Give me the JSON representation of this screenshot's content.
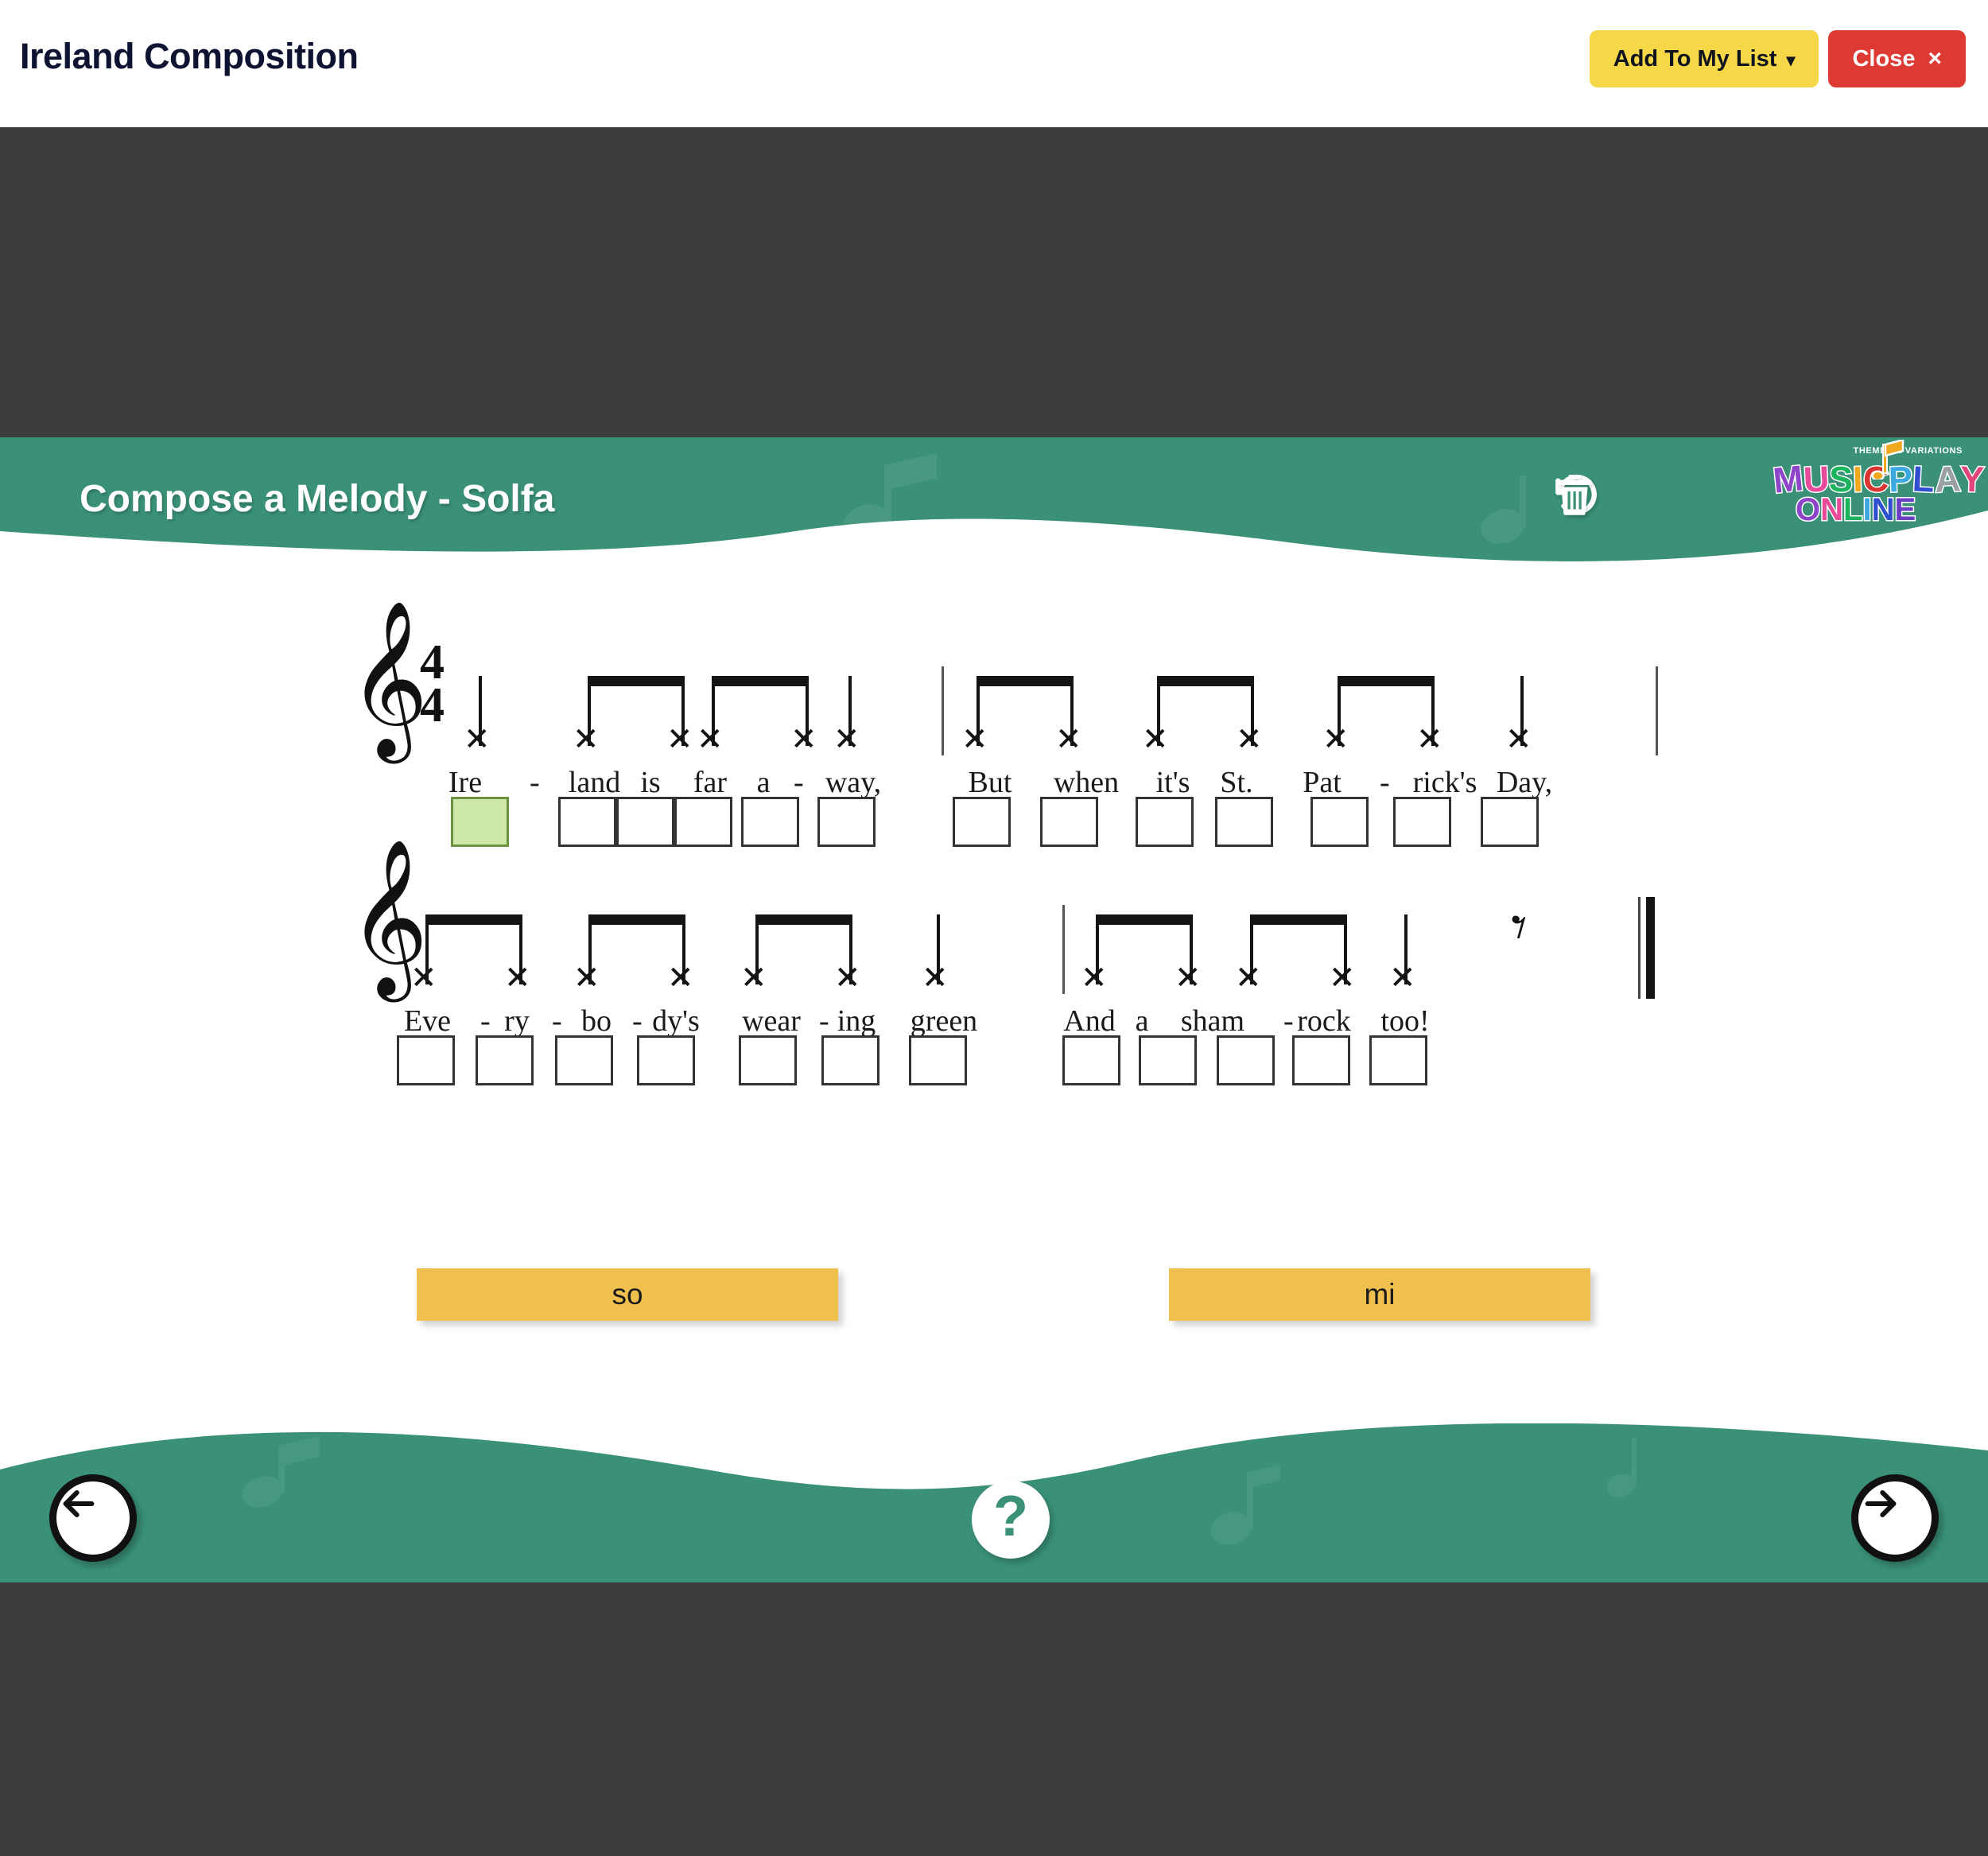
{
  "window": {
    "title": "Ireland Composition",
    "add_to_list_label": "Add To My List",
    "add_to_list_chevron": "chevron-down-icon",
    "close_label": "Close",
    "close_glyph": "×"
  },
  "activity_header": {
    "title": "Compose a Melody - Solfa",
    "undo_icon": "undo-icon",
    "delete_icon": "trash-icon"
  },
  "logo": {
    "tagline": "THEMES & VARIATIONS",
    "word1": "MUSICPLAY",
    "word2": "ONLINE",
    "colors": [
      "#8e44c9",
      "#e84a9a",
      "#f0a81e",
      "#3ba9df",
      "#1bb35c",
      "#2f4fd0",
      "#9aa0a6",
      "#e0457b",
      "#6b3fc4"
    ]
  },
  "score": {
    "clef": "treble-clef",
    "time_signature": {
      "numerator": "4",
      "denominator": "4"
    },
    "systems": [
      {
        "id": "system-1",
        "lyrics": [
          "Ire",
          "land",
          "is",
          "far",
          "a",
          "way,",
          "But",
          "when",
          "it's",
          "St.",
          "Pat",
          "rick's",
          "Day,"
        ],
        "hyphens": [
          "-",
          "",
          "",
          "",
          "-",
          "",
          "",
          "",
          "",
          "",
          "-",
          "",
          ""
        ],
        "rhythm": [
          "quarter",
          "eighth",
          "eighth",
          "eighth",
          "eighth",
          "quarter",
          "eighth",
          "eighth",
          "eighth",
          "eighth",
          "eighth",
          "eighth",
          "quarter"
        ],
        "boxes_filled": [
          true,
          false,
          false,
          false,
          false,
          false,
          false,
          false,
          false,
          false,
          false,
          false,
          false
        ]
      },
      {
        "id": "system-2",
        "lyrics": [
          "Eve",
          "ry",
          "bo",
          "dy's",
          "wear",
          "ing",
          "green",
          "And",
          "a",
          "sham",
          "rock",
          "too!"
        ],
        "hyphens": [
          "-",
          "-",
          "-",
          "",
          "-",
          "",
          "",
          "",
          "",
          "-",
          "",
          ""
        ],
        "rhythm": [
          "eighth",
          "eighth",
          "eighth",
          "eighth",
          "eighth",
          "eighth",
          "quarter",
          "eighth",
          "eighth",
          "eighth",
          "eighth",
          "quarter"
        ],
        "boxes_filled": [
          false,
          false,
          false,
          false,
          false,
          false,
          false,
          false,
          false,
          false,
          false,
          false
        ],
        "final_rest": "quarter-rest",
        "final_barline": "double-final"
      }
    ]
  },
  "solfa_palette": [
    {
      "label": "so",
      "color": "#f0c04e"
    },
    {
      "label": "mi",
      "color": "#f0c04e"
    }
  ],
  "footer_nav": {
    "back_icon": "arrow-left-icon",
    "help_glyph": "?",
    "forward_icon": "arrow-right-icon"
  },
  "colors": {
    "accent_green": "#3a9178",
    "dark_band": "#3d3d3d",
    "yellow": "#f5d747",
    "red": "#dc3a33",
    "solfa_yellow": "#f0c04e",
    "filled_box": "#cde8a8"
  }
}
